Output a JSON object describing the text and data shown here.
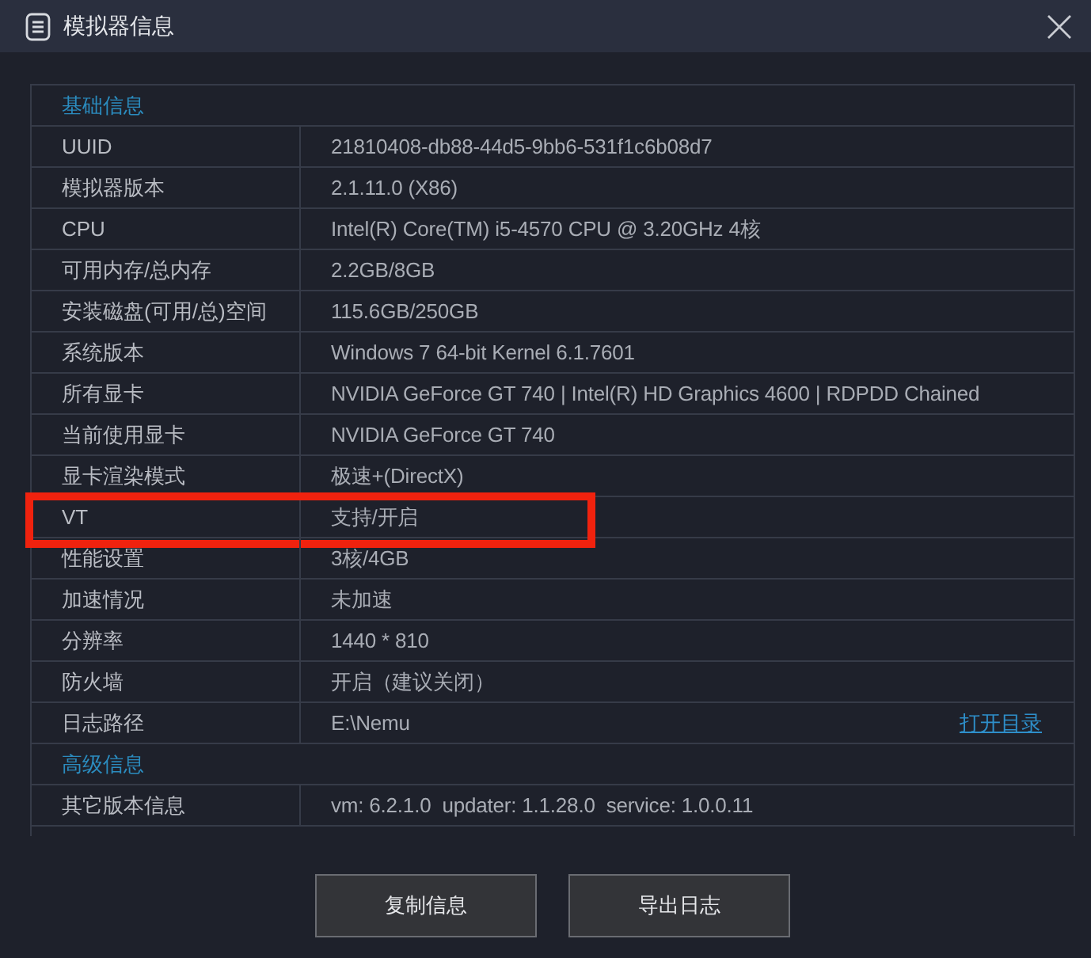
{
  "window": {
    "title": "模拟器信息"
  },
  "sections": [
    {
      "title": "基础信息",
      "rows": [
        {
          "label": "UUID",
          "value": "21810408-db88-44d5-9bb6-531f1c6b08d7",
          "highlighted": false
        },
        {
          "label": "模拟器版本",
          "value": "2.1.11.0 (X86)",
          "highlighted": false
        },
        {
          "label": "CPU",
          "value": "Intel(R) Core(TM) i5-4570 CPU @ 3.20GHz 4核",
          "highlighted": false
        },
        {
          "label": "可用内存/总内存",
          "value": "2.2GB/8GB",
          "highlighted": false
        },
        {
          "label": "安装磁盘(可用/总)空间",
          "value": "115.6GB/250GB",
          "highlighted": false
        },
        {
          "label": "系统版本",
          "value": "Windows 7 64-bit Kernel 6.1.7601",
          "highlighted": false
        },
        {
          "label": "所有显卡",
          "value": "NVIDIA GeForce GT 740 | Intel(R) HD Graphics 4600 | RDPDD Chained",
          "highlighted": false
        },
        {
          "label": "当前使用显卡",
          "value": "NVIDIA GeForce GT 740",
          "highlighted": false
        },
        {
          "label": "显卡渲染模式",
          "value": "极速+(DirectX)",
          "highlighted": false
        },
        {
          "label": "VT",
          "value": "支持/开启",
          "highlighted": true
        },
        {
          "label": "性能设置",
          "value": "3核/4GB",
          "highlighted": false
        },
        {
          "label": "加速情况",
          "value": "未加速",
          "highlighted": false
        },
        {
          "label": "分辨率",
          "value": "1440 * 810",
          "highlighted": false
        },
        {
          "label": "防火墙",
          "value": "开启（建议关闭）",
          "highlighted": false
        },
        {
          "label": "日志路径",
          "value": "E:\\Nemu",
          "link": "打开目录",
          "highlighted": false
        }
      ]
    },
    {
      "title": "高级信息",
      "rows": [
        {
          "label": "其它版本信息",
          "value": "vm: 6.2.1.0  updater: 1.1.28.0  service: 1.0.0.11",
          "highlighted": false
        }
      ]
    }
  ],
  "buttons": [
    "复制信息",
    "导出日志"
  ]
}
